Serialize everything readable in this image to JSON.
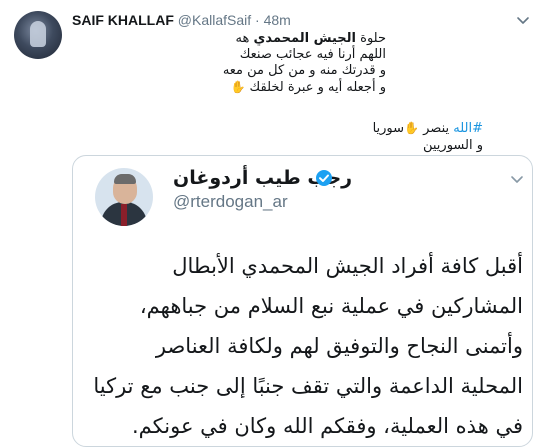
{
  "tweet": {
    "author_name": "SAIF KHALLAF",
    "author_handle": "@KallafSaif",
    "separator": "·",
    "time": "48m",
    "text_line1_prefix": "حلوة ",
    "text_line1_bold": "الجيش المحمدي",
    "text_line1_suffix": " هه",
    "text_line2": "اللهم أرنا فيه عجائب صنعك",
    "text_line3": "و قدرتك منه و من كل من معه",
    "text_line4": "و أجعله أيه و عبرة لخلقك",
    "hashtag": "#الله",
    "tag_line_mid": " ينصر ",
    "tag_line_end": "سوريا",
    "tag_line2": "و السوريين",
    "emoji_icon": "folded-hands-emoji"
  },
  "quoted": {
    "name": "رجب طيب أردوغان",
    "handle": "@rterdogan_ar",
    "lines": [
      "أقبل كافة أفراد الجيش المحمدي الأبطال",
      "المشاركين في عملية نبع السلام من جباههم،",
      "وأتمنى النجاح والتوفيق لهم ولكافة العناصر",
      "المحلية الداعمة والتي تقف جنبًا إلى جنب مع تركيا",
      "في هذه العملية، وفقكم الله وكان في عونكم."
    ]
  },
  "colors": {
    "link": "#1b95e0",
    "secondary_text": "#657786",
    "border": "#ccd6dd"
  }
}
